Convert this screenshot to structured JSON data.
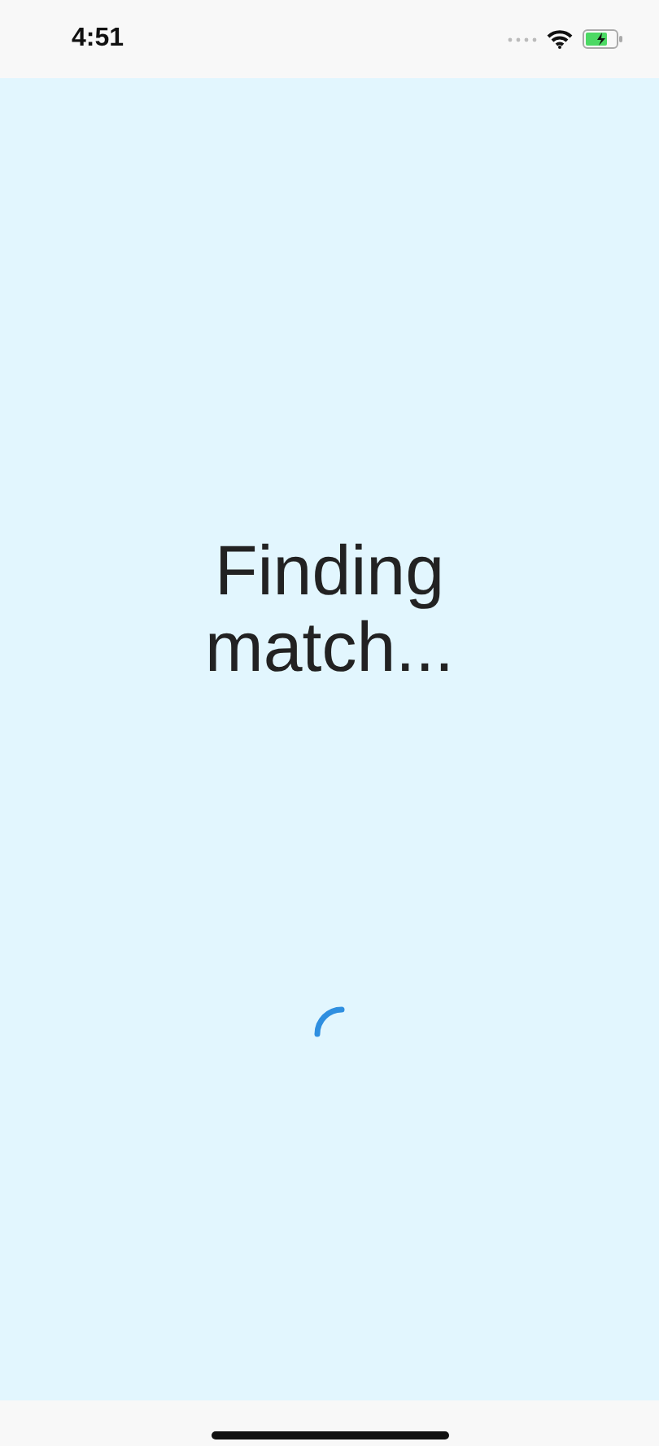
{
  "status_bar": {
    "time": "4:51"
  },
  "title": "Finding match..."
}
